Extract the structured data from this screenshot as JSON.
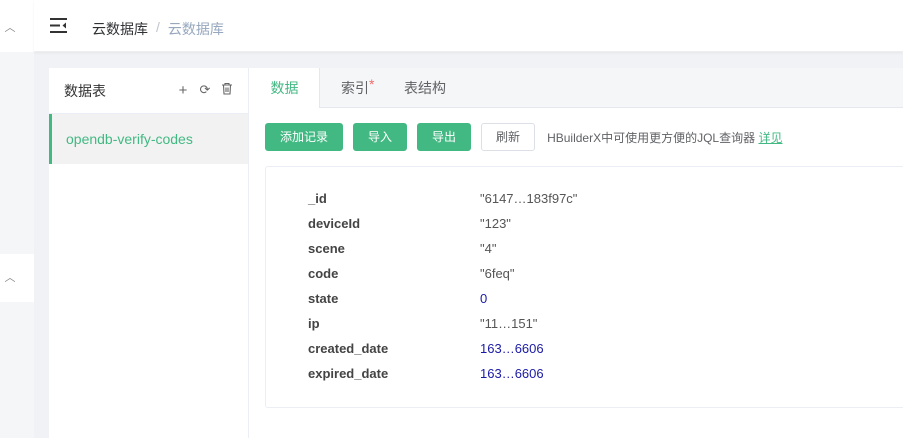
{
  "breadcrumb": {
    "root": "云数据库",
    "separator": "/",
    "current": "云数据库"
  },
  "tables": {
    "title": "数据表",
    "items": [
      "opendb-verify-codes"
    ]
  },
  "tabs": [
    {
      "label": "数据",
      "active": true
    },
    {
      "label": "索引",
      "marked": "*"
    },
    {
      "label": "表结构"
    }
  ],
  "toolbar": {
    "add": "添加记录",
    "import": "导入",
    "export": "导出",
    "refresh": "刷新",
    "hint": "HBuilderX中可使用更方便的JQL查询器",
    "hint_link": "详见"
  },
  "record": [
    {
      "key": "_id",
      "value": "\"6147…183f97c\""
    },
    {
      "key": "deviceId",
      "value": "\"123\""
    },
    {
      "key": "scene",
      "value": "\"4\""
    },
    {
      "key": "code",
      "value": "\"6feq\""
    },
    {
      "key": "state",
      "value": "0"
    },
    {
      "key": "ip",
      "value": "\"11…151\""
    },
    {
      "key": "created_date",
      "value": "163…6606"
    },
    {
      "key": "expired_date",
      "value": "163…6606"
    }
  ],
  "colors": {
    "accent": "#42b983",
    "number": "#1a1aa6",
    "required": "#f56c6c"
  }
}
